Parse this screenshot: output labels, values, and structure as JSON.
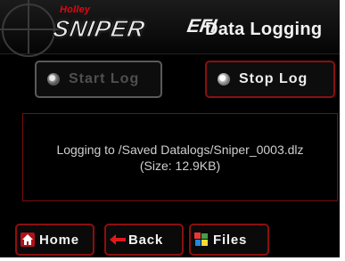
{
  "header": {
    "brand_top": "Holley",
    "brand_main": "SNIPER",
    "brand_efi": "EFI",
    "title": "Data Logging"
  },
  "buttons": {
    "start_log": "Start Log",
    "stop_log": "Stop Log"
  },
  "status": {
    "line1": "Logging to /Saved Datalogs/Sniper_0003.dlz",
    "line2": "(Size: 12.9KB)"
  },
  "nav": {
    "home": "Home",
    "back": "Back",
    "files": "Files"
  },
  "colors": {
    "background": "#000000",
    "accent_red": "#8c0f0f",
    "brand_red": "#e30613",
    "disabled_text": "#4f4f4f",
    "text": "#ededed"
  },
  "icons": [
    "home-icon",
    "back-arrow-icon",
    "files-icon",
    "radio-icon"
  ]
}
